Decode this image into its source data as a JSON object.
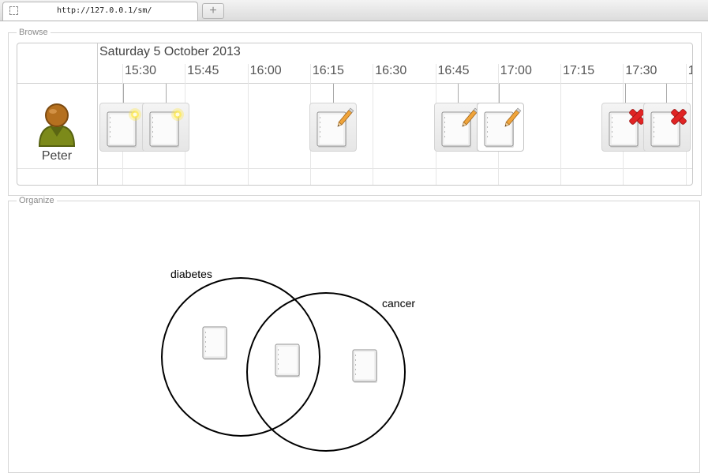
{
  "browser": {
    "tab_title": "http://127.0.0.1/sm/",
    "new_tab_label": "+"
  },
  "browse": {
    "legend": "Browse",
    "date": "Saturday 5 October 2013",
    "times": [
      "15:30",
      "15:45",
      "16:00",
      "16:15",
      "16:30",
      "16:45",
      "17:00",
      "17:15",
      "17:30",
      "1"
    ],
    "person": {
      "name": "Peter",
      "icon": "user-icon"
    },
    "events": [
      {
        "kind": "new",
        "icon": "document-new-icon"
      },
      {
        "kind": "new",
        "icon": "document-new-icon"
      },
      {
        "kind": "edit",
        "icon": "document-edit-icon"
      },
      {
        "kind": "edit",
        "icon": "document-edit-icon"
      },
      {
        "kind": "edit",
        "icon": "document-edit-icon",
        "selected": true
      },
      {
        "kind": "delete",
        "icon": "document-delete-icon"
      },
      {
        "kind": "delete",
        "icon": "document-delete-icon"
      }
    ]
  },
  "organize": {
    "legend": "Organize",
    "sets": [
      {
        "label": "diabetes"
      },
      {
        "label": "cancer"
      }
    ],
    "documents": [
      {
        "icon": "document-icon",
        "membership": [
          "diabetes"
        ]
      },
      {
        "icon": "document-icon",
        "membership": [
          "diabetes",
          "cancer"
        ]
      },
      {
        "icon": "document-icon",
        "membership": [
          "cancer"
        ]
      }
    ]
  },
  "colors": {
    "new_glow": "#ffe94a",
    "pencil": "#f0a43a",
    "delete_x": "#e02424",
    "person_body": "#7c8a1a",
    "person_head": "#b5701f"
  }
}
